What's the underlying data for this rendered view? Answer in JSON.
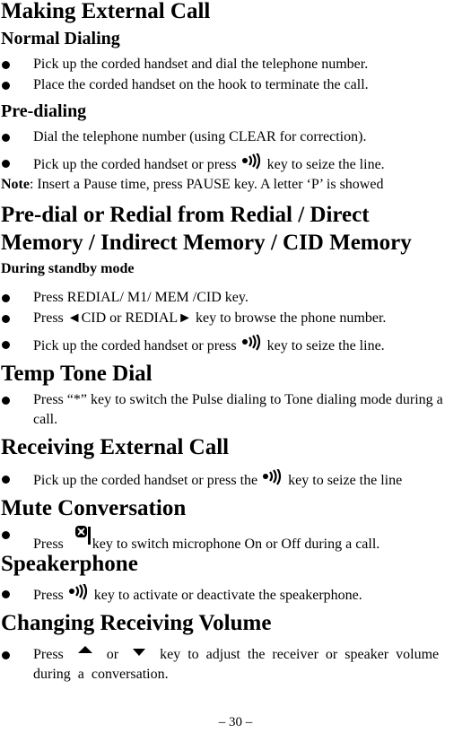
{
  "page": {
    "sections": {
      "making_external_call": {
        "title": "Making External Call",
        "normal_dialing": {
          "title": "Normal Dialing",
          "items": [
            "Pick up the corded handset and dial the telephone number.",
            "Place the corded handset on the hook to terminate the call."
          ]
        },
        "pre_dialing": {
          "title": "Pre-dialing",
          "items": [
            "Dial the telephone number (using CLEAR for correction).",
            {
              "before": "Pick up the corded handset or press",
              "icon": "speaker-key-icon",
              "after": "key to seize the line."
            }
          ],
          "note_label": "Note",
          "note_text": ": Insert a Pause time, press PAUSE key. A letter ‘P’ is showed"
        }
      },
      "pre_dial_redial": {
        "title_line1": "Pre-dial or Redial from Redial / Direct",
        "title_line2": "Memory / Indirect Memory / CID Memory",
        "subtitle": "During standby mode",
        "items": [
          "Press REDIAL/ M1/ MEM /CID key.",
          "Press ◄CID or REDIAL► key to browse the phone number.",
          {
            "before": "Pick up the corded handset or press",
            "icon": "speaker-key-icon",
            "after": "key to seize the line."
          }
        ]
      },
      "temp_tone_dial": {
        "title": "Temp Tone Dial",
        "items": [
          "Press “*” key to switch the Pulse dialing to Tone dialing mode during a call."
        ]
      },
      "receiving_external_call": {
        "title": "Receiving External Call",
        "items": [
          {
            "before": "Pick up the corded handset or press the",
            "icon": "speaker-key-icon",
            "after": "key to seize the line"
          }
        ]
      },
      "mute_conversation": {
        "title": "Mute Conversation",
        "items": [
          {
            "before": "Press",
            "icon": "mute-key-icon",
            "after": "key to switch microphone On or Off during a call."
          }
        ]
      },
      "speakerphone": {
        "title": "Speakerphone",
        "items": [
          {
            "before": "Press",
            "icon": "speaker-key-icon",
            "after": "key to activate or deactivate the speakerphone."
          }
        ]
      },
      "changing_receiving_volume": {
        "title": "Changing Receiving Volume",
        "items": [
          {
            "before": "Press",
            "icon1": "volume-up-icon",
            "middle": "or",
            "icon2": "volume-down-icon",
            "after": "key to adjust the receiver or speaker volume during a conversation."
          }
        ]
      }
    },
    "footer": {
      "page_number": "– 30 –"
    }
  }
}
